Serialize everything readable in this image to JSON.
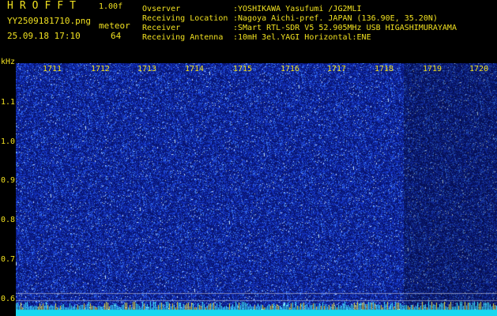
{
  "header": {
    "app_name": "HROFFT",
    "version": "1.00f",
    "filename": "YY2509181710.png",
    "mode": "meteor",
    "datetime": "25.09.18 17:10",
    "count": "64"
  },
  "info": [
    {
      "key": "Ovserver",
      "value": ":YOSHIKAWA Yasufumi /JG2MLI"
    },
    {
      "key": "Receiving Location",
      "value": ":Nagoya Aichi-pref. JAPAN (136.90E, 35.20N)"
    },
    {
      "key": "Receiver",
      "value": ":SMart RTL-SDR V5 52.905MHz USB HIGASHIMURAYAMA"
    },
    {
      "key": "Receiving Antenna",
      "value": ":10mH 3el.YAGI Horizontal:ENE"
    }
  ],
  "y_axis": {
    "unit": "kHz",
    "ticks": [
      "1.1",
      "1.0",
      "0.9",
      "0.8",
      "0.7",
      "0.6"
    ]
  },
  "time_labels": [
    "1711",
    "1712",
    "1713",
    "1714",
    "1715",
    "1716",
    "1717",
    "1718",
    "1719",
    "1720"
  ],
  "colors": {
    "label": "#f0e020",
    "spectrum_base": "#0a1a80",
    "noise": "#3a7aff",
    "baseline": "#20e0f0"
  }
}
